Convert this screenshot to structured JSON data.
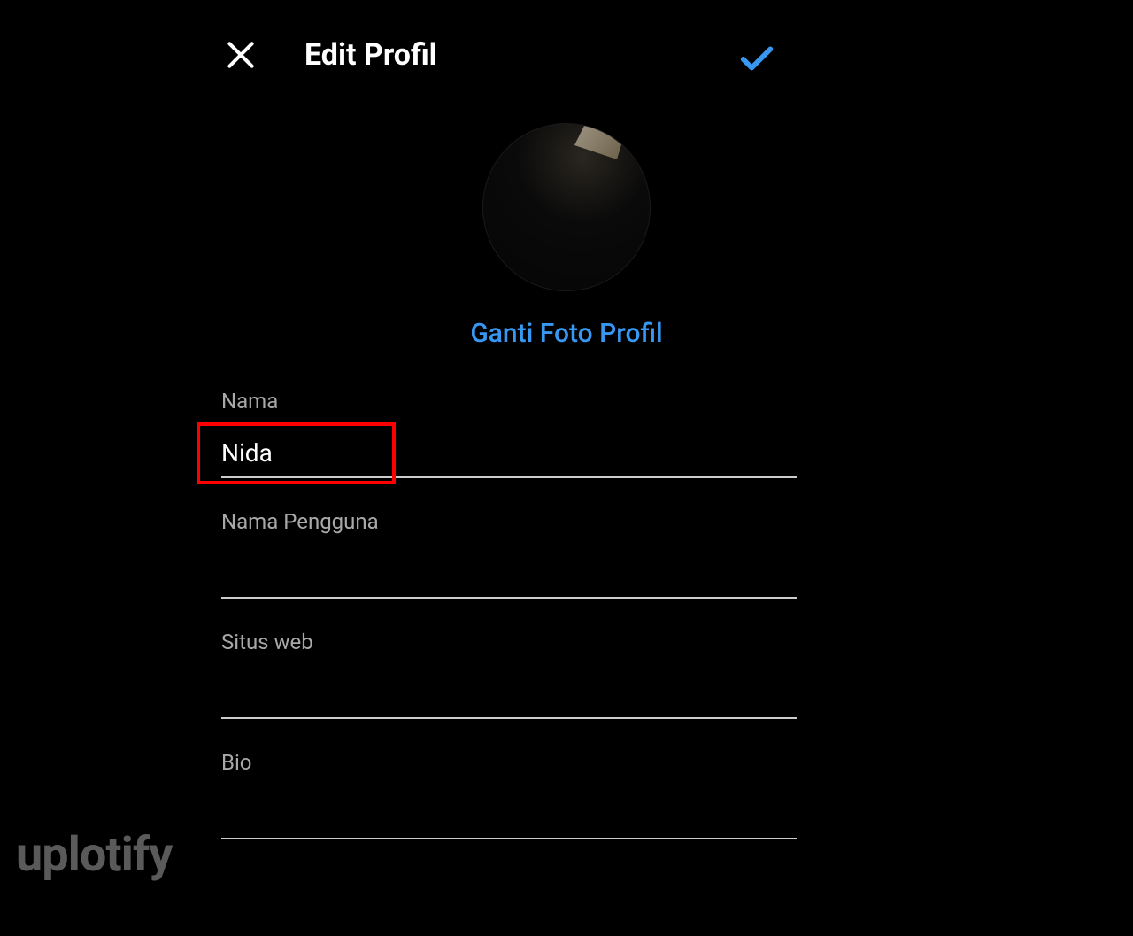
{
  "header": {
    "title": "Edit Profil"
  },
  "profile": {
    "change_photo_label": "Ganti Foto Profil"
  },
  "fields": {
    "name": {
      "label": "Nama",
      "value": "Nida"
    },
    "username": {
      "label": "Nama Pengguna",
      "value": ""
    },
    "website": {
      "label": "Situs web",
      "value": ""
    },
    "bio": {
      "label": "Bio",
      "value": ""
    }
  },
  "watermark": "uplotify",
  "colors": {
    "accent": "#3897f0",
    "highlight": "#ff0000"
  }
}
